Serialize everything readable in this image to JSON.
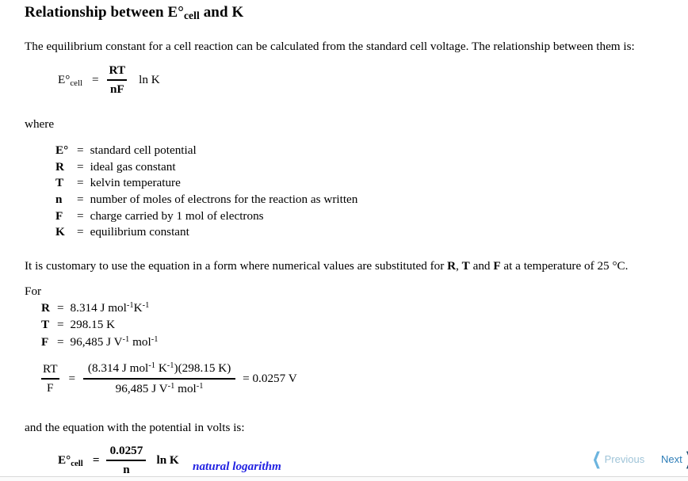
{
  "document": {
    "title_prefix": "Relationship between E°",
    "title_sub": "cell",
    "title_suffix": " and K",
    "intro_paragraph": "The equilibrium constant for a cell reaction can be calculated from the standard cell voltage. The relationship between them is:",
    "where_label": "where",
    "customary_paragraph_part1": "It is customary to use the equation in a form where numerical values are substituted for ",
    "customary_bold1": "R",
    "customary_mid1": ", ",
    "customary_bold2": "T",
    "customary_mid2": " and ",
    "customary_bold3": "F",
    "customary_paragraph_part2": " at a temperature of 25 °C.",
    "for_label": "For",
    "and_equation_paragraph": "and the equation with the potential in volts is:"
  },
  "equation_main": {
    "lhs_symbol": "E°",
    "lhs_sub": "cell",
    "equals": "=",
    "numerator": "RT",
    "denominator": "nF",
    "trailing": "ln K"
  },
  "definitions": {
    "equals": "=",
    "rows": [
      {
        "symbol": "E°",
        "meaning": "standard cell potential"
      },
      {
        "symbol": "R",
        "meaning": "ideal gas constant"
      },
      {
        "symbol": "T",
        "meaning": "kelvin temperature"
      },
      {
        "symbol": "n",
        "meaning": "number of moles of electrons for the reaction as written"
      },
      {
        "symbol": "F",
        "meaning": "charge carried by 1 mol of electrons"
      },
      {
        "symbol": "K",
        "meaning": "equilibrium constant"
      }
    ]
  },
  "values": {
    "equals": "=",
    "rows": [
      {
        "symbol": "R",
        "value_number": "8.314",
        "unit_parts": [
          {
            "base": " J mol",
            "exp": "-1"
          },
          {
            "base": "K",
            "exp": "-1"
          }
        ]
      },
      {
        "symbol": "T",
        "value_number": "298.15",
        "unit_parts": [
          {
            "base": " K",
            "exp": ""
          }
        ]
      },
      {
        "symbol": "F",
        "value_number": "96,485",
        "unit_parts": [
          {
            "base": " J V",
            "exp": "-1"
          },
          {
            "base": " mol",
            "exp": "-1"
          }
        ]
      }
    ]
  },
  "equation_rtf": {
    "lhs_numerator": "RT",
    "lhs_denominator": "F",
    "equals1": "=",
    "num_open": "(8.314 J mol",
    "num_exp1": "-1",
    "num_mid": " K",
    "num_exp2": "-1",
    "num_close": ")(298.15 K)",
    "den_text": "96,485 J V",
    "den_exp1": "-1",
    "den_mid": " mol",
    "den_exp2": "-1",
    "equals2": "=",
    "result": "0.0257 V"
  },
  "equation_final": {
    "lhs_symbol": "E°",
    "lhs_sub": "cell",
    "equals": "=",
    "numerator": "0.0257",
    "denominator": "n",
    "trailing": "ln K",
    "annotation": "natural logarithm",
    "annotation_color": "#2222e2"
  },
  "navigation": {
    "previous_label": "Previous",
    "previous_icon": "chevron-left-icon",
    "previous_color": "#9fc4d8",
    "next_label": "Next",
    "next_icon": "chevron-right-icon",
    "next_color": "#2e7eb8"
  }
}
